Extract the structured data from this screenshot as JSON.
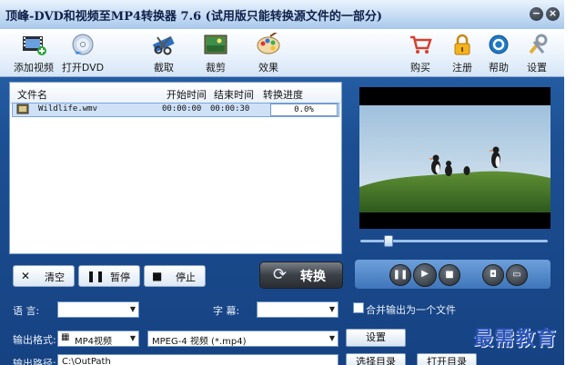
{
  "window": {
    "title": "顶峰-DVD和视频至MP4转换器 7.6 (试用版只能转换源文件的一部分)",
    "minimize_symbol": "−",
    "close_symbol": "×"
  },
  "toolbar": {
    "add_video": "添加视频",
    "open_dvd": "打开DVD",
    "clip": "截取",
    "crop": "裁剪",
    "effect": "效果",
    "buy": "购买",
    "register": "注册",
    "help": "帮助",
    "settings": "设置"
  },
  "file_list": {
    "columns": [
      "文件名",
      "开始时间",
      "结束时间",
      "转换进度"
    ],
    "rows": [
      {
        "name": "Wildlife.wmv",
        "start": "00:00:00",
        "end": "00:00:30",
        "progress": "0.0%"
      }
    ]
  },
  "actions": {
    "clear": "清空",
    "pause": "暂停",
    "stop": "停止",
    "convert": "转换"
  },
  "player": {
    "position_fraction": 0.15
  },
  "options": {
    "audio_label": "语  言:",
    "subtitle_label": "字  幕:",
    "merge_label": "合并输出为一个文件",
    "format_label": "输出格式:",
    "format_value": "MP4视频",
    "codec_value": "MPEG-4 视频 (*.mp4)",
    "settings_button": "设置",
    "output_label": "输出路径:",
    "output_value": "C:\\OutPath",
    "choose_dir": "选择目录",
    "open_dir": "打开目录"
  },
  "watermark": "最需教育"
}
